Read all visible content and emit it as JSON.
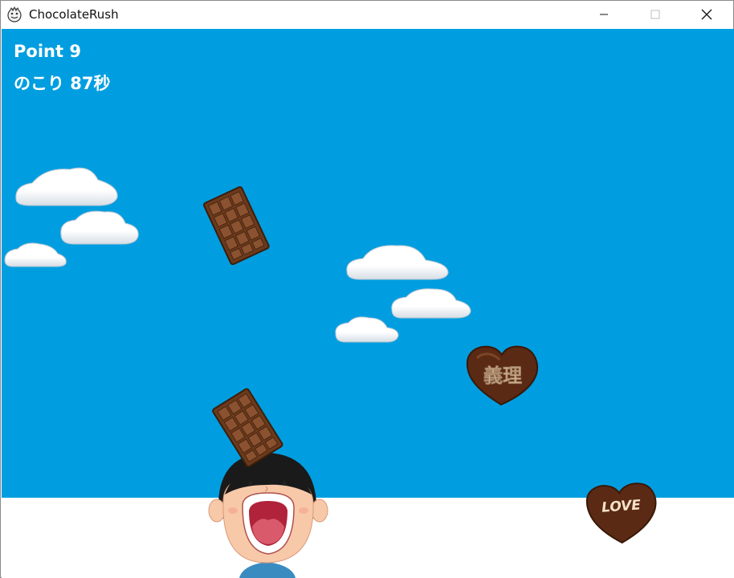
{
  "window": {
    "title": "ChocolateRush",
    "minimize_glyph": "minimize-icon",
    "maximize_glyph": "maximize-icon",
    "close_glyph": "close-icon"
  },
  "hud": {
    "point_text": "Point 9",
    "time_text": "のこり 87秒"
  },
  "items": {
    "giri_heart_text": "義理",
    "love_heart_text": "LOVE"
  },
  "colors": {
    "sky": "#009ee0",
    "ground": "#ffffff",
    "chocolate": "#7b4423",
    "heart_chocolate": "#5a2a14"
  }
}
